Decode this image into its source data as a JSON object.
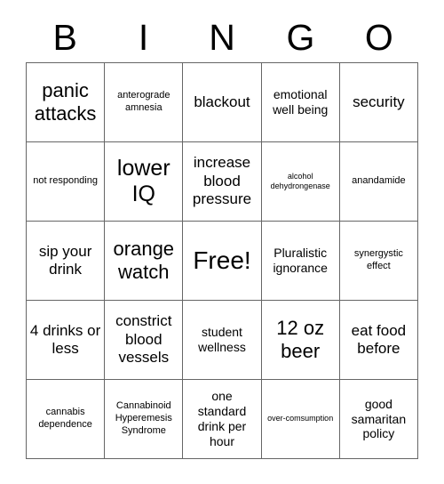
{
  "card": {
    "title": "BINGO",
    "header_letters": [
      "B",
      "I",
      "N",
      "G",
      "O"
    ],
    "free_space_label": "Free!",
    "grid_rows": 5,
    "grid_cols": 5,
    "colors": {
      "background": "#ffffff",
      "border": "#666666",
      "text": "#000000"
    },
    "cells": [
      [
        {
          "text": "panic attacks",
          "size": "xl"
        },
        {
          "text": "anterograde amnesia",
          "size": "s"
        },
        {
          "text": "blackout",
          "size": "l"
        },
        {
          "text": "emotional well being",
          "size": "m"
        },
        {
          "text": "security",
          "size": "l"
        }
      ],
      [
        {
          "text": "not responding",
          "size": "s"
        },
        {
          "text": "lower IQ",
          "size": "xxl"
        },
        {
          "text": "increase blood pressure",
          "size": "l"
        },
        {
          "text": "alcohol dehydrongenase",
          "size": "xs"
        },
        {
          "text": "anandamide",
          "size": "s"
        }
      ],
      [
        {
          "text": "sip your drink",
          "size": "l"
        },
        {
          "text": "orange watch",
          "size": "xl"
        },
        {
          "text": "Free!",
          "size": "free"
        },
        {
          "text": "Pluralistic ignorance",
          "size": "m"
        },
        {
          "text": "synergystic effect",
          "size": "s"
        }
      ],
      [
        {
          "text": "4 drinks or less",
          "size": "l"
        },
        {
          "text": "constrict blood vessels",
          "size": "l"
        },
        {
          "text": "student wellness",
          "size": "m"
        },
        {
          "text": "12 oz beer",
          "size": "xl"
        },
        {
          "text": "eat food before",
          "size": "l"
        }
      ],
      [
        {
          "text": "cannabis dependence",
          "size": "s"
        },
        {
          "text": "Cannabinoid Hyperemesis Syndrome",
          "size": "s"
        },
        {
          "text": "one standard drink per hour",
          "size": "m"
        },
        {
          "text": "over-comsumption",
          "size": "xs"
        },
        {
          "text": "good samaritan policy",
          "size": "m"
        }
      ]
    ]
  }
}
